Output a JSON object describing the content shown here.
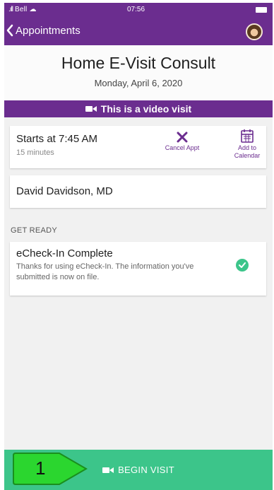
{
  "status": {
    "carrier": "Bell",
    "time": "07:56"
  },
  "nav": {
    "back_label": "Appointments"
  },
  "visit": {
    "title": "Home E-Visit Consult",
    "date": "Monday, April 6, 2020",
    "video_banner": "This is a video visit"
  },
  "appointment": {
    "starts": "Starts at 7:45 AM",
    "duration": "15 minutes",
    "cancel_label": "Cancel Appt",
    "calendar_label_line1": "Add to",
    "calendar_label_line2": "Calendar"
  },
  "provider": {
    "name": "David Davidson, MD"
  },
  "get_ready": {
    "heading": "GET READY",
    "checkin_title": "eCheck-In Complete",
    "checkin_desc": "Thanks for using eCheck-In. The information you've submitted is now on file."
  },
  "begin_button": {
    "label": "BEGIN VISIT"
  },
  "annotation": {
    "step": "1"
  },
  "colors": {
    "brand": "#6b2d8f",
    "success": "#3cc58a",
    "page_bg": "#f1f1f1"
  },
  "icons": {
    "back": "chevron-left-icon",
    "video": "video-camera-icon",
    "cancel": "x-icon",
    "calendar": "calendar-icon",
    "check": "check-circle-icon"
  }
}
